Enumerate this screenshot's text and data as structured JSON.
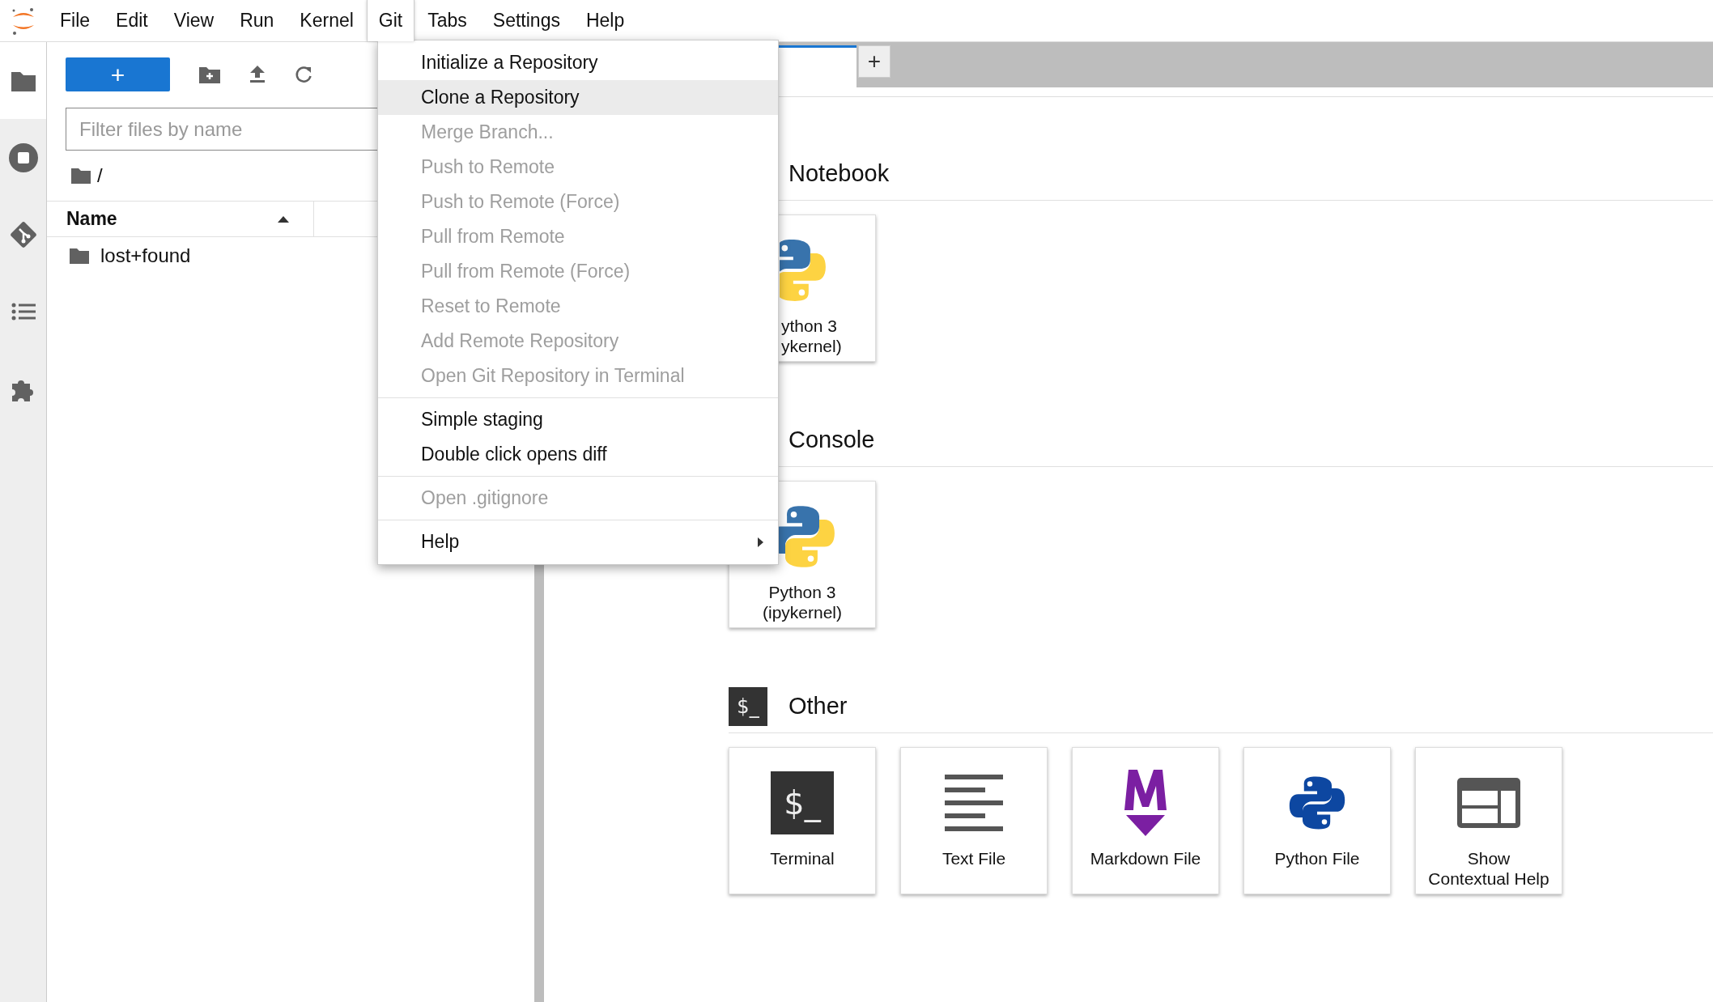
{
  "menu_bar": [
    {
      "label": "File",
      "selected": false
    },
    {
      "label": "Edit",
      "selected": false
    },
    {
      "label": "View",
      "selected": false
    },
    {
      "label": "Run",
      "selected": false
    },
    {
      "label": "Kernel",
      "selected": false
    },
    {
      "label": "Git",
      "selected": true
    },
    {
      "label": "Tabs",
      "selected": false
    },
    {
      "label": "Settings",
      "selected": false
    },
    {
      "label": "Help",
      "selected": false
    }
  ],
  "activity_bar": [
    {
      "kind": "files",
      "selected": true
    },
    {
      "kind": "running",
      "selected": false
    },
    {
      "kind": "git",
      "selected": false
    },
    {
      "kind": "toc",
      "selected": false
    },
    {
      "kind": "extensions",
      "selected": false
    }
  ],
  "file_browser": {
    "new_button": "+",
    "filter": {
      "placeholder": "Filter files by name"
    },
    "breadcrumb": "/",
    "column": "Name",
    "rows": [
      {
        "name": "lost+found"
      }
    ]
  },
  "tab_bar": {
    "add_button": "+"
  },
  "launcher": [
    {
      "title": "Notebook",
      "kind": "notebook",
      "cards": [
        {
          "kind": "python",
          "lines": [
            "ython 3",
            "ykernel)"
          ],
          "partly_hidden": true
        }
      ]
    },
    {
      "title": "Console",
      "kind": "console",
      "cards": [
        {
          "kind": "python",
          "lines": [
            "Python 3",
            "(ipykernel)"
          ],
          "partly_hidden": false
        }
      ]
    },
    {
      "title": "Other",
      "kind": "other",
      "icon_text": "$_",
      "cards": [
        {
          "kind": "terminal",
          "icon_text": "$_",
          "lines": [
            "Terminal"
          ],
          "partly_hidden": false
        },
        {
          "kind": "text",
          "lines": [
            "Text File"
          ],
          "partly_hidden": false
        },
        {
          "kind": "markdown",
          "lines": [
            "Markdown File"
          ],
          "partly_hidden": false
        },
        {
          "kind": "pyfile",
          "lines": [
            "Python File"
          ],
          "partly_hidden": false
        },
        {
          "kind": "help",
          "lines": [
            "Show",
            "Contextual Help"
          ],
          "partly_hidden": false
        }
      ]
    }
  ],
  "git_menu": [
    [
      {
        "label": "Initialize a Repository",
        "disabled": false,
        "highlighted": false,
        "submenu": false
      },
      {
        "label": "Clone a Repository",
        "disabled": false,
        "highlighted": true,
        "submenu": false
      },
      {
        "label": "Merge Branch...",
        "disabled": true,
        "highlighted": false,
        "submenu": false
      },
      {
        "label": "Push to Remote",
        "disabled": true,
        "highlighted": false,
        "submenu": false
      },
      {
        "label": "Push to Remote (Force)",
        "disabled": true,
        "highlighted": false,
        "submenu": false
      },
      {
        "label": "Pull from Remote",
        "disabled": true,
        "highlighted": false,
        "submenu": false
      },
      {
        "label": "Pull from Remote (Force)",
        "disabled": true,
        "highlighted": false,
        "submenu": false
      },
      {
        "label": "Reset to Remote",
        "disabled": true,
        "highlighted": false,
        "submenu": false
      },
      {
        "label": "Add Remote Repository",
        "disabled": true,
        "highlighted": false,
        "submenu": false
      },
      {
        "label": "Open Git Repository in Terminal",
        "disabled": true,
        "highlighted": false,
        "submenu": false
      }
    ],
    [
      {
        "label": "Simple staging",
        "disabled": false,
        "highlighted": false,
        "submenu": false
      },
      {
        "label": "Double click opens diff",
        "disabled": false,
        "highlighted": false,
        "submenu": false
      }
    ],
    [
      {
        "label": "Open .gitignore",
        "disabled": true,
        "highlighted": false,
        "submenu": false
      }
    ],
    [
      {
        "label": "Help",
        "disabled": false,
        "highlighted": false,
        "submenu": true
      }
    ]
  ]
}
